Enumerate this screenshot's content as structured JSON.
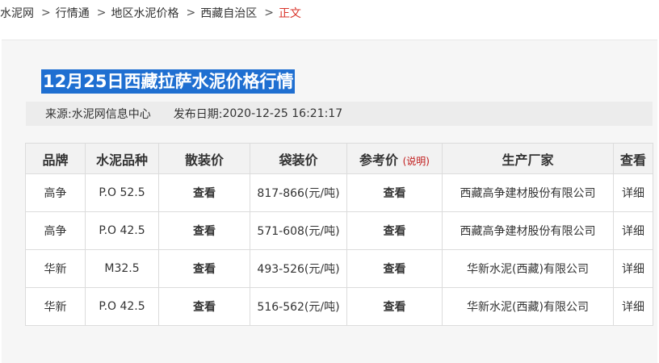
{
  "breadcrumb": {
    "items": [
      "水泥网",
      "行情通",
      "地区水泥价格",
      "西藏自治区"
    ],
    "current": "正文",
    "separator": ">"
  },
  "article": {
    "title": "12月25日西藏拉萨水泥价格行情",
    "source_label": "来源:",
    "source": "水泥网信息中心",
    "date_label": "发布日期:",
    "date": "2020-12-25 16:21:17"
  },
  "table": {
    "headers": {
      "brand": "品牌",
      "variety": "水泥品种",
      "bulk": "散装价",
      "bag": "袋装价",
      "ref": "参考价",
      "ref_note": "(说明)",
      "maker": "生产厂家",
      "view": "查看"
    },
    "rows": [
      {
        "brand": "高争",
        "variety": "P.O 52.5",
        "bulk": "查看",
        "bag": "817-866(元/吨)",
        "ref": "查看",
        "maker": "西藏高争建材股份有限公司",
        "detail": "详细"
      },
      {
        "brand": "高争",
        "variety": "P.O 42.5",
        "bulk": "查看",
        "bag": "571-608(元/吨)",
        "ref": "查看",
        "maker": "西藏高争建材股份有限公司",
        "detail": "详细"
      },
      {
        "brand": "华新",
        "variety": "M32.5",
        "bulk": "查看",
        "bag": "493-526(元/吨)",
        "ref": "查看",
        "maker": "华新水泥(西藏)有限公司",
        "detail": "详细"
      },
      {
        "brand": "华新",
        "variety": "P.O 42.5",
        "bulk": "查看",
        "bag": "516-562(元/吨)",
        "ref": "查看",
        "maker": "华新水泥(西藏)有限公司",
        "detail": "详细"
      }
    ]
  },
  "colors": {
    "title_highlight": "#1f6fd1",
    "link_blue": "#1c4fa6",
    "accent_red": "#c01818"
  }
}
